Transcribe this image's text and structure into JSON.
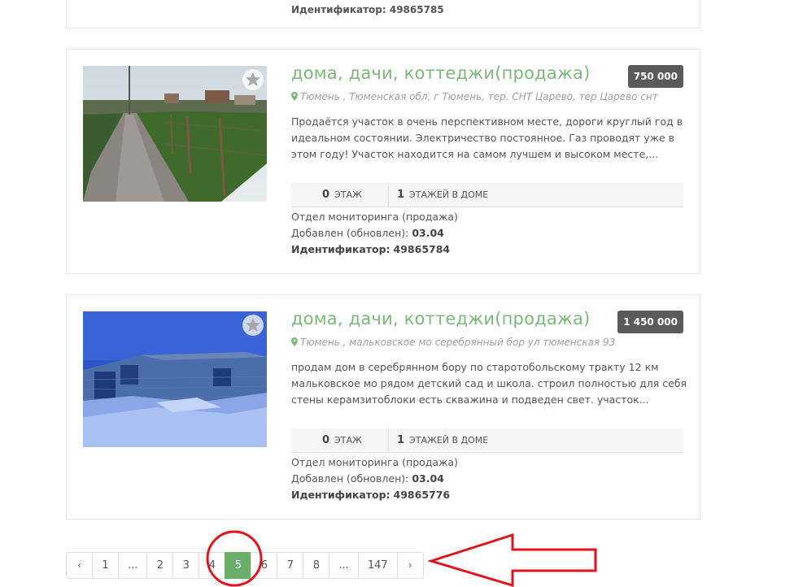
{
  "previous_listing": {
    "id_label": "Идентификатор:",
    "id_value": "49865785"
  },
  "listings": [
    {
      "title": "дома, дачи, коттеджи(продажа)",
      "price": "750 000",
      "address": "Тюмень , Тюменская обл, г Тюмень, тер. СНТ Царево, тер Царево снт",
      "description": "Продаётся участок в очень перспективном месте, дороги круглый год в идеальном состоянии. Электричество постоянное. Газ проводят уже в этом году! Участок находится на самом лучшем и высоком месте,...",
      "floor_value": "0",
      "floor_label": "ЭТАЖ",
      "floors_value": "1",
      "floors_label": "ЭТАЖЕЙ В ДОМЕ",
      "department": "Отдел мониторинга (продажа)",
      "added_label": "Добавлен (обновлен):",
      "added_value": "03.04",
      "id_label": "Идентификатор:",
      "id_value": "49865784",
      "photo_icon": "field-road-photo",
      "favorite_icon": "star-icon"
    },
    {
      "title": "дома, дачи, коттеджи(продажа)",
      "price": "1 450 000",
      "address": "Тюмень , мальковское мо серебрянный бор ул тюменская 93",
      "description": "продам дом в серебрянном бору по старотобольскому тракту 12 км мальковское мо рядом детский сад и школа. строил полностью для себя стены керамзитоблоки есть скважина и подведен свет. участок...",
      "floor_value": "0",
      "floor_label": "ЭТАЖ",
      "floors_value": "1",
      "floors_label": "ЭТАЖЕЙ В ДОМЕ",
      "department": "Отдел мониторинга (продажа)",
      "added_label": "Добавлен (обновлен):",
      "added_value": "03.04",
      "id_label": "Идентификатор:",
      "id_value": "49865776",
      "photo_icon": "snow-house-photo",
      "favorite_icon": "star-icon"
    }
  ],
  "pagination": {
    "prev": "‹",
    "items": [
      "1",
      "...",
      "2",
      "3",
      "4",
      "5",
      "6",
      "7",
      "8",
      "...",
      "147"
    ],
    "next": "›",
    "current": "5"
  },
  "colors": {
    "title_green": "#7bb87a",
    "active_page": "#6aae6a",
    "price_badge": "#5a5a5a",
    "annotation_red": "#e0141e"
  }
}
